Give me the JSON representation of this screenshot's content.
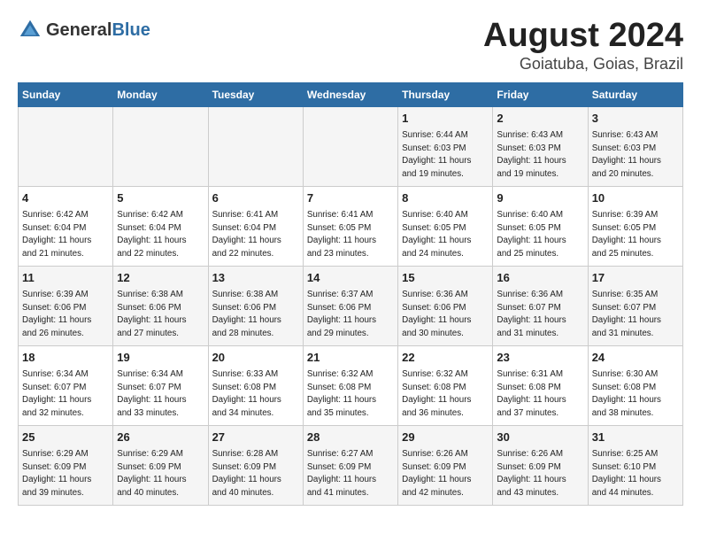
{
  "header": {
    "logo_general": "General",
    "logo_blue": "Blue",
    "month_title": "August 2024",
    "location": "Goiatuba, Goias, Brazil"
  },
  "days_of_week": [
    "Sunday",
    "Monday",
    "Tuesday",
    "Wednesday",
    "Thursday",
    "Friday",
    "Saturday"
  ],
  "weeks": [
    [
      {
        "day": "",
        "info": ""
      },
      {
        "day": "",
        "info": ""
      },
      {
        "day": "",
        "info": ""
      },
      {
        "day": "",
        "info": ""
      },
      {
        "day": "1",
        "info": "Sunrise: 6:44 AM\nSunset: 6:03 PM\nDaylight: 11 hours\nand 19 minutes."
      },
      {
        "day": "2",
        "info": "Sunrise: 6:43 AM\nSunset: 6:03 PM\nDaylight: 11 hours\nand 19 minutes."
      },
      {
        "day": "3",
        "info": "Sunrise: 6:43 AM\nSunset: 6:03 PM\nDaylight: 11 hours\nand 20 minutes."
      }
    ],
    [
      {
        "day": "4",
        "info": "Sunrise: 6:42 AM\nSunset: 6:04 PM\nDaylight: 11 hours\nand 21 minutes."
      },
      {
        "day": "5",
        "info": "Sunrise: 6:42 AM\nSunset: 6:04 PM\nDaylight: 11 hours\nand 22 minutes."
      },
      {
        "day": "6",
        "info": "Sunrise: 6:41 AM\nSunset: 6:04 PM\nDaylight: 11 hours\nand 22 minutes."
      },
      {
        "day": "7",
        "info": "Sunrise: 6:41 AM\nSunset: 6:05 PM\nDaylight: 11 hours\nand 23 minutes."
      },
      {
        "day": "8",
        "info": "Sunrise: 6:40 AM\nSunset: 6:05 PM\nDaylight: 11 hours\nand 24 minutes."
      },
      {
        "day": "9",
        "info": "Sunrise: 6:40 AM\nSunset: 6:05 PM\nDaylight: 11 hours\nand 25 minutes."
      },
      {
        "day": "10",
        "info": "Sunrise: 6:39 AM\nSunset: 6:05 PM\nDaylight: 11 hours\nand 25 minutes."
      }
    ],
    [
      {
        "day": "11",
        "info": "Sunrise: 6:39 AM\nSunset: 6:06 PM\nDaylight: 11 hours\nand 26 minutes."
      },
      {
        "day": "12",
        "info": "Sunrise: 6:38 AM\nSunset: 6:06 PM\nDaylight: 11 hours\nand 27 minutes."
      },
      {
        "day": "13",
        "info": "Sunrise: 6:38 AM\nSunset: 6:06 PM\nDaylight: 11 hours\nand 28 minutes."
      },
      {
        "day": "14",
        "info": "Sunrise: 6:37 AM\nSunset: 6:06 PM\nDaylight: 11 hours\nand 29 minutes."
      },
      {
        "day": "15",
        "info": "Sunrise: 6:36 AM\nSunset: 6:06 PM\nDaylight: 11 hours\nand 30 minutes."
      },
      {
        "day": "16",
        "info": "Sunrise: 6:36 AM\nSunset: 6:07 PM\nDaylight: 11 hours\nand 31 minutes."
      },
      {
        "day": "17",
        "info": "Sunrise: 6:35 AM\nSunset: 6:07 PM\nDaylight: 11 hours\nand 31 minutes."
      }
    ],
    [
      {
        "day": "18",
        "info": "Sunrise: 6:34 AM\nSunset: 6:07 PM\nDaylight: 11 hours\nand 32 minutes."
      },
      {
        "day": "19",
        "info": "Sunrise: 6:34 AM\nSunset: 6:07 PM\nDaylight: 11 hours\nand 33 minutes."
      },
      {
        "day": "20",
        "info": "Sunrise: 6:33 AM\nSunset: 6:08 PM\nDaylight: 11 hours\nand 34 minutes."
      },
      {
        "day": "21",
        "info": "Sunrise: 6:32 AM\nSunset: 6:08 PM\nDaylight: 11 hours\nand 35 minutes."
      },
      {
        "day": "22",
        "info": "Sunrise: 6:32 AM\nSunset: 6:08 PM\nDaylight: 11 hours\nand 36 minutes."
      },
      {
        "day": "23",
        "info": "Sunrise: 6:31 AM\nSunset: 6:08 PM\nDaylight: 11 hours\nand 37 minutes."
      },
      {
        "day": "24",
        "info": "Sunrise: 6:30 AM\nSunset: 6:08 PM\nDaylight: 11 hours\nand 38 minutes."
      }
    ],
    [
      {
        "day": "25",
        "info": "Sunrise: 6:29 AM\nSunset: 6:09 PM\nDaylight: 11 hours\nand 39 minutes."
      },
      {
        "day": "26",
        "info": "Sunrise: 6:29 AM\nSunset: 6:09 PM\nDaylight: 11 hours\nand 40 minutes."
      },
      {
        "day": "27",
        "info": "Sunrise: 6:28 AM\nSunset: 6:09 PM\nDaylight: 11 hours\nand 40 minutes."
      },
      {
        "day": "28",
        "info": "Sunrise: 6:27 AM\nSunset: 6:09 PM\nDaylight: 11 hours\nand 41 minutes."
      },
      {
        "day": "29",
        "info": "Sunrise: 6:26 AM\nSunset: 6:09 PM\nDaylight: 11 hours\nand 42 minutes."
      },
      {
        "day": "30",
        "info": "Sunrise: 6:26 AM\nSunset: 6:09 PM\nDaylight: 11 hours\nand 43 minutes."
      },
      {
        "day": "31",
        "info": "Sunrise: 6:25 AM\nSunset: 6:10 PM\nDaylight: 11 hours\nand 44 minutes."
      }
    ]
  ]
}
